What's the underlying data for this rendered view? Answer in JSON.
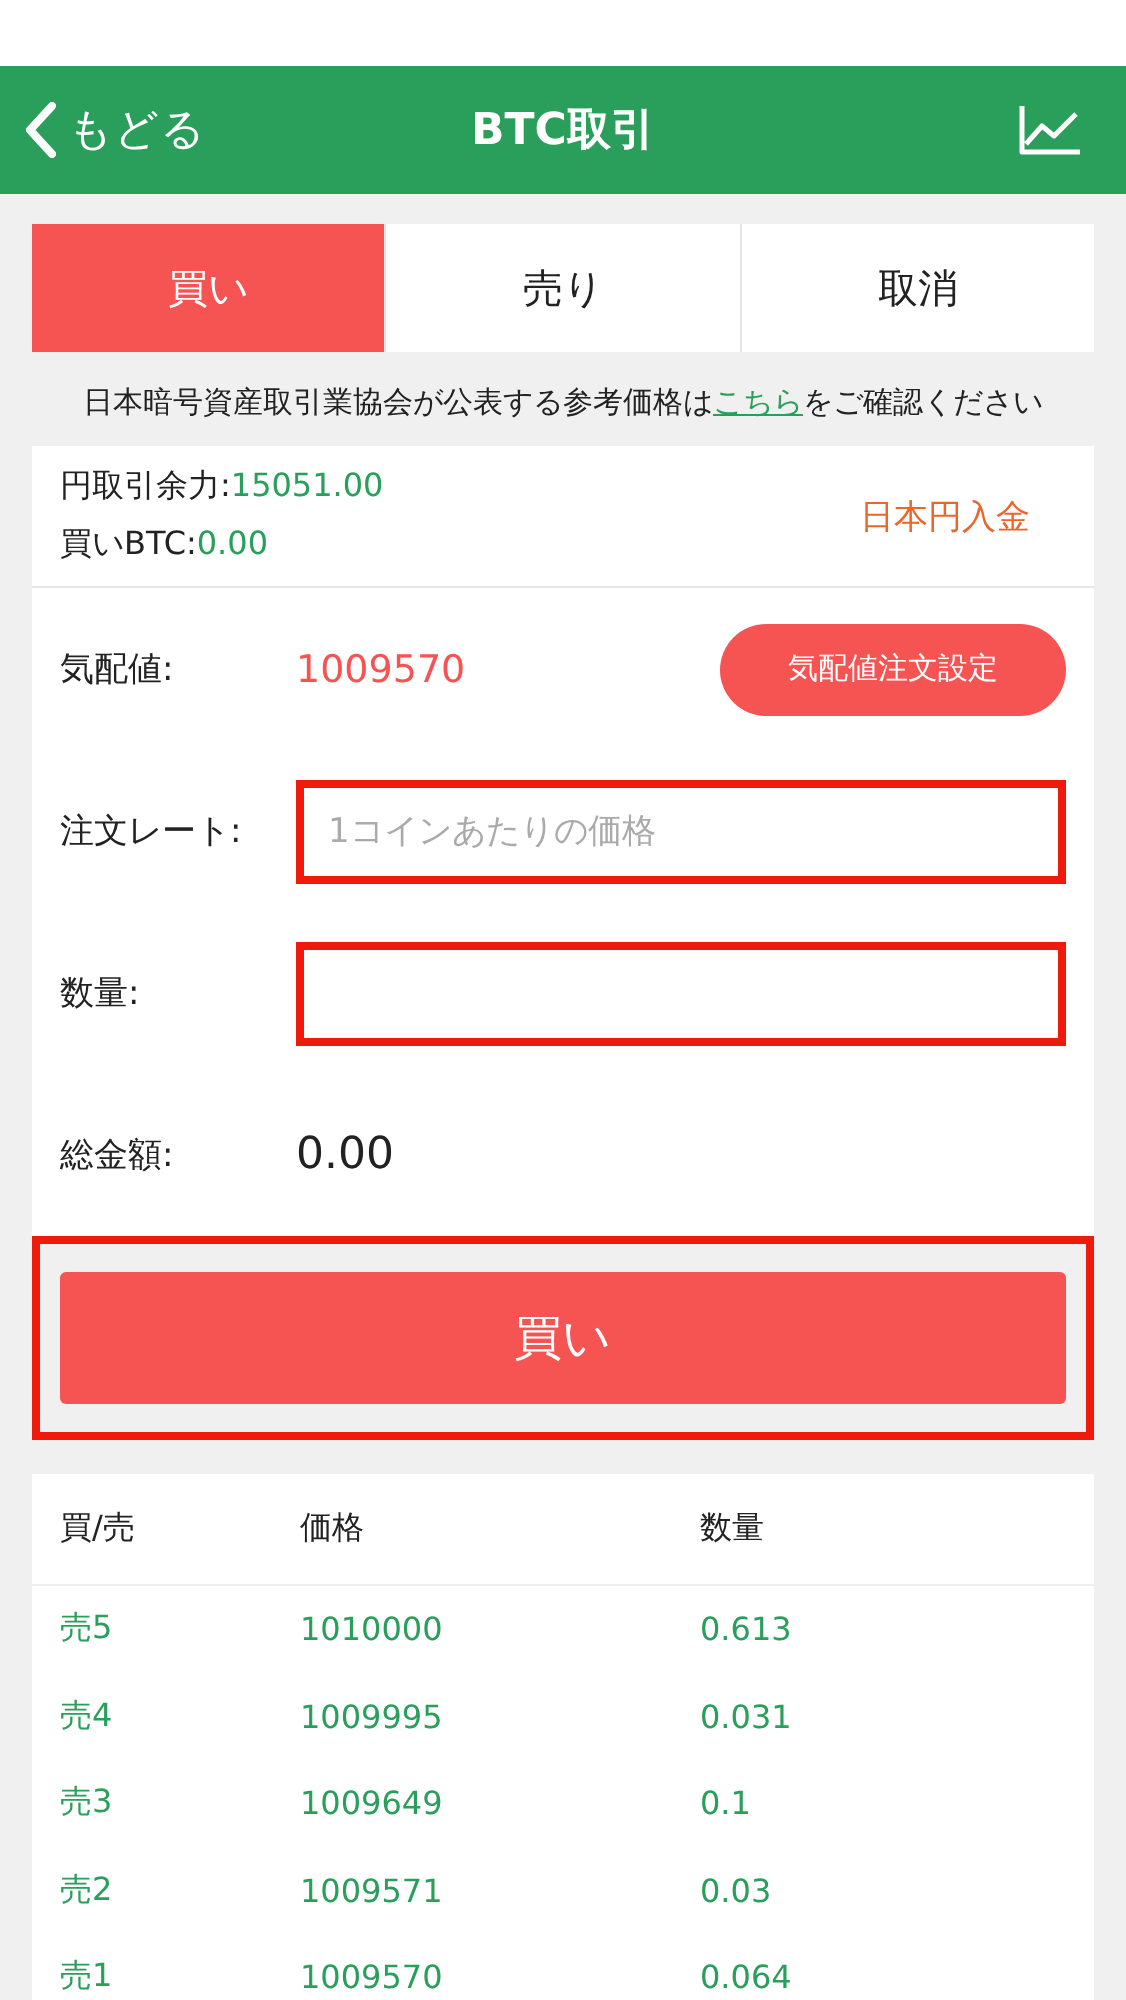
{
  "header": {
    "back": "もどる",
    "title": "BTC取引"
  },
  "tabs": [
    {
      "label": "買い",
      "selected": true
    },
    {
      "label": "売り",
      "selected": false
    },
    {
      "label": "取消",
      "selected": false
    }
  ],
  "notice": {
    "before": "日本暗号資産取引業協会が公表する参考価格は",
    "link": "こちら",
    "after": "をご確認ください"
  },
  "balance": {
    "yen_label": "円取引余力:",
    "yen_value": "15051.00",
    "btc_label": "買いBTC:",
    "btc_value": "0.00",
    "deposit": "日本円入金"
  },
  "form": {
    "quote_label": "気配値:",
    "quote_value": "1009570",
    "quote_button": "気配値注文設定",
    "rate_label": "注文レート:",
    "rate_placeholder": "1コインあたりの価格",
    "amount_label": "数量:",
    "total_label": "総金額:",
    "total_value": "0.00",
    "submit": "買い"
  },
  "order_book": {
    "columns": [
      "買/売",
      "価格",
      "数量"
    ],
    "rows": [
      {
        "side": "売5",
        "price": "1010000",
        "amount": "0.613"
      },
      {
        "side": "売4",
        "price": "1009995",
        "amount": "0.031"
      },
      {
        "side": "売3",
        "price": "1009649",
        "amount": "0.1"
      },
      {
        "side": "売2",
        "price": "1009571",
        "amount": "0.03"
      },
      {
        "side": "売1",
        "price": "1009570",
        "amount": "0.064"
      }
    ]
  }
}
